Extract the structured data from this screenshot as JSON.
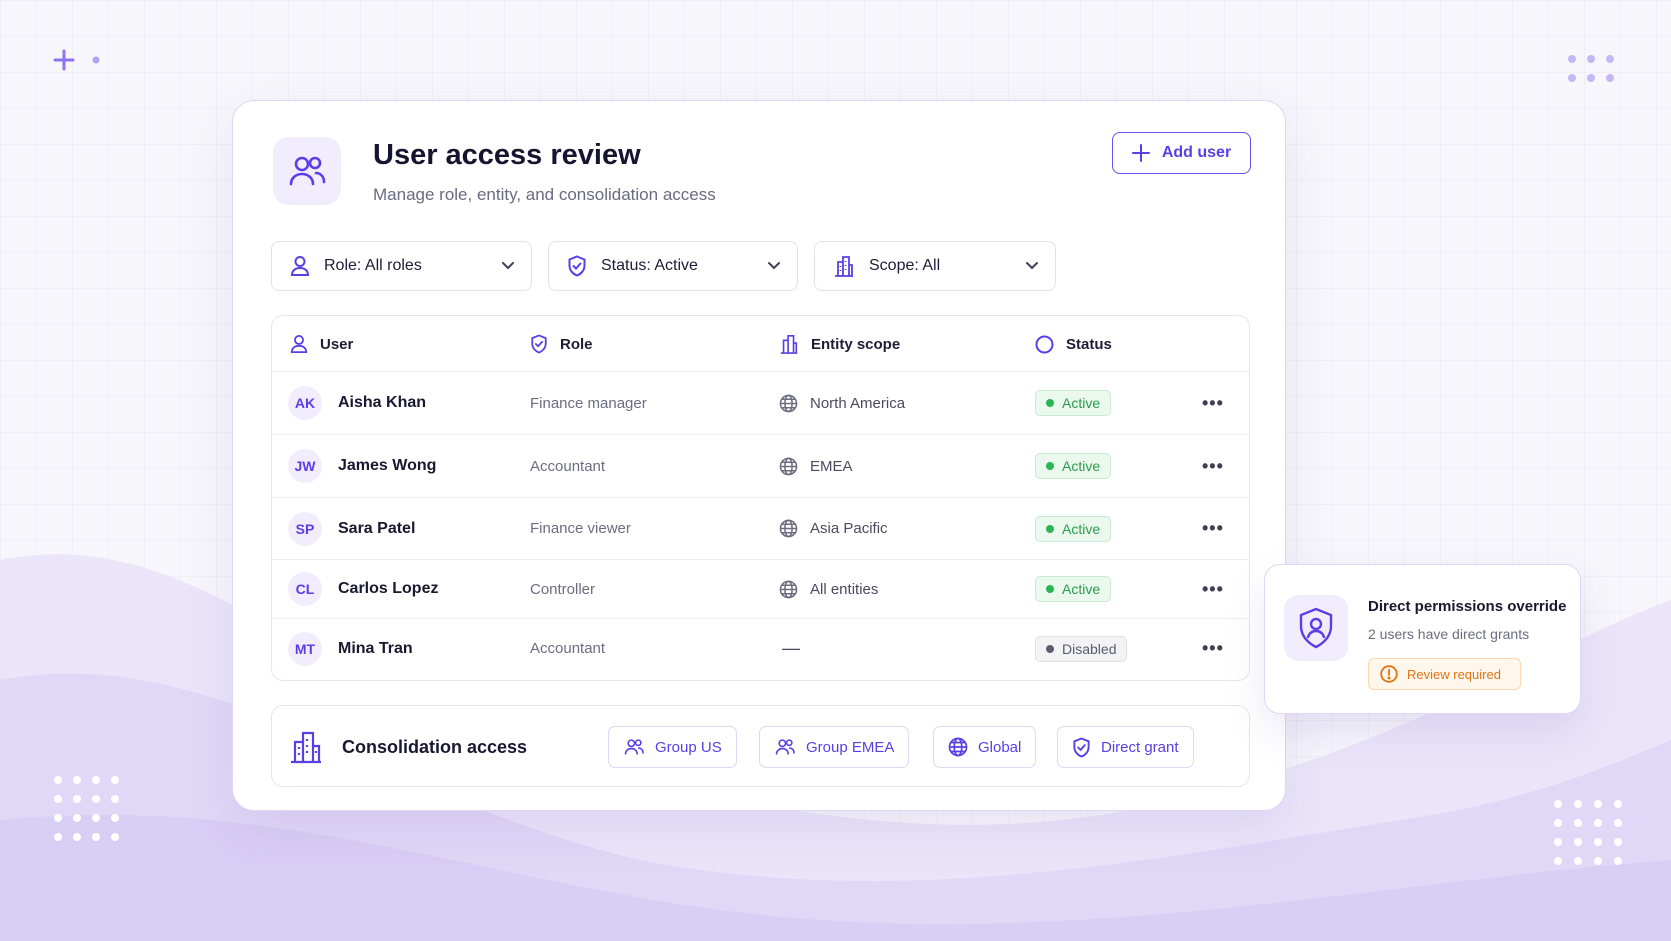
{
  "header": {
    "title": "User access review",
    "subtitle": "Manage role, entity, and consolidation access",
    "add_user_label": "Add user"
  },
  "filters": [
    {
      "label": "Role: All roles",
      "icon": "user-icon"
    },
    {
      "label": "Status: Active",
      "icon": "shield-icon"
    },
    {
      "label": "Scope: All",
      "icon": "building-icon"
    }
  ],
  "table": {
    "columns": [
      "User",
      "Role",
      "Entity scope",
      "Status"
    ],
    "rows": [
      {
        "initials": "AK",
        "name": "Aisha Khan",
        "role": "Finance manager",
        "scope": "North America",
        "status": "Active"
      },
      {
        "initials": "JW",
        "name": "James Wong",
        "role": "Accountant",
        "scope": "EMEA",
        "status": "Active"
      },
      {
        "initials": "SP",
        "name": "Sara Patel",
        "role": "Finance viewer",
        "scope": "Asia Pacific",
        "status": "Active"
      },
      {
        "initials": "CL",
        "name": "Carlos Lopez",
        "role": "Controller",
        "scope": "All entities",
        "status": "Active"
      },
      {
        "initials": "MT",
        "name": "Mina Tran",
        "role": "Accountant",
        "scope": "—",
        "status": "Disabled"
      }
    ]
  },
  "consolidation": {
    "title": "Consolidation access",
    "chips": [
      "Group US",
      "Group EMEA",
      "Global",
      "Direct grant"
    ]
  },
  "popover": {
    "title": "Direct permissions override",
    "subtitle": "2 users have direct grants",
    "badge": "Review required"
  },
  "colors": {
    "accent": "#5a3ee6",
    "active": "#2a9c4a",
    "warning": "#e07413"
  }
}
